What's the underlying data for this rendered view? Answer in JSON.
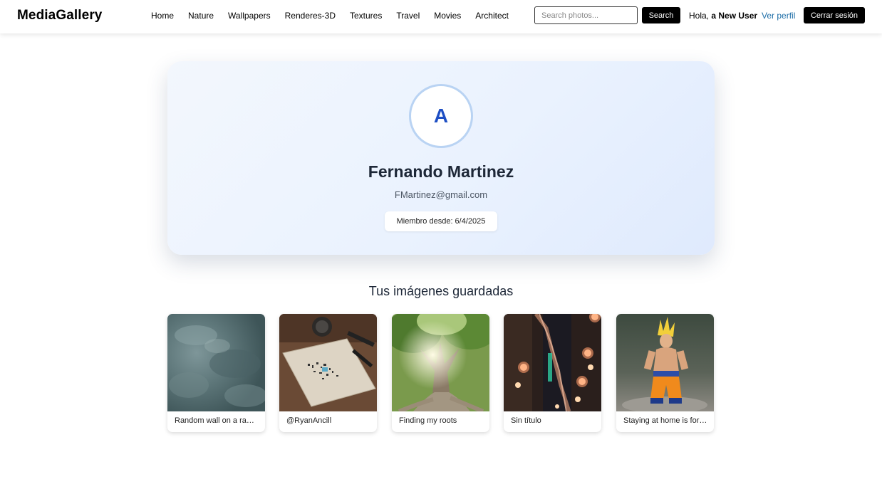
{
  "navbar": {
    "brand": "MediaGallery",
    "links": [
      "Home",
      "Nature",
      "Wallpapers",
      "Renderes-3D",
      "Textures",
      "Travel",
      "Movies",
      "Architect"
    ],
    "search_placeholder": "Search photos...",
    "search_label": "Search",
    "greeting_prefix": "Hola, ",
    "greeting_user": "a New User",
    "profile_link": "Ver perfil",
    "logout_label": "Cerrar sesión"
  },
  "profile": {
    "avatar_letter": "A",
    "name": "Fernando Martinez",
    "email": "FMartinez@gmail.com",
    "member_since": "Miembro desde: 6/4/2025"
  },
  "saved": {
    "title": "Tus imágenes guardadas",
    "items": [
      {
        "caption": "Random wall on a random street",
        "image": "textured-wall-photo"
      },
      {
        "caption": "@RyanAncill",
        "image": "desk-sketchbook-photo"
      },
      {
        "caption": "Finding my roots",
        "image": "tree-roots-photo"
      },
      {
        "caption": "Sin título",
        "image": "city-lights-photo"
      },
      {
        "caption": "Staying at home is for the weak",
        "image": "goku-figure-photo"
      }
    ]
  },
  "colors": {
    "accent": "#1e4fc4",
    "link": "#1f6fa8",
    "button": "#000000"
  }
}
